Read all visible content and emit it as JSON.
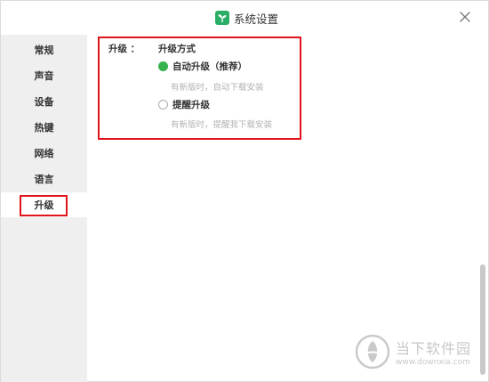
{
  "window": {
    "title": "系统设置",
    "logo_icon": "sprout-icon",
    "close_icon": "close-icon"
  },
  "sidebar": {
    "items": [
      {
        "label": "常规",
        "active": false
      },
      {
        "label": "声音",
        "active": false
      },
      {
        "label": "设备",
        "active": false
      },
      {
        "label": "热键",
        "active": false
      },
      {
        "label": "网络",
        "active": false
      },
      {
        "label": "语言",
        "active": false
      },
      {
        "label": "升级",
        "active": true
      }
    ]
  },
  "upgrade": {
    "row_label": "升级 ：",
    "section_title": "升级方式",
    "options": [
      {
        "label": "自动升级（推荐）",
        "hint": "有新版时，自动下载安装",
        "checked": true
      },
      {
        "label": "提醒升级",
        "hint": "有新版时，提醒我下载安装",
        "checked": false
      }
    ]
  },
  "watermark": {
    "brand": "当下软件园",
    "url": "www.downxia.com"
  },
  "colors": {
    "accent_green": "#37b24d",
    "highlight_red": "#e0141a",
    "sidebar_bg": "#efefef"
  }
}
